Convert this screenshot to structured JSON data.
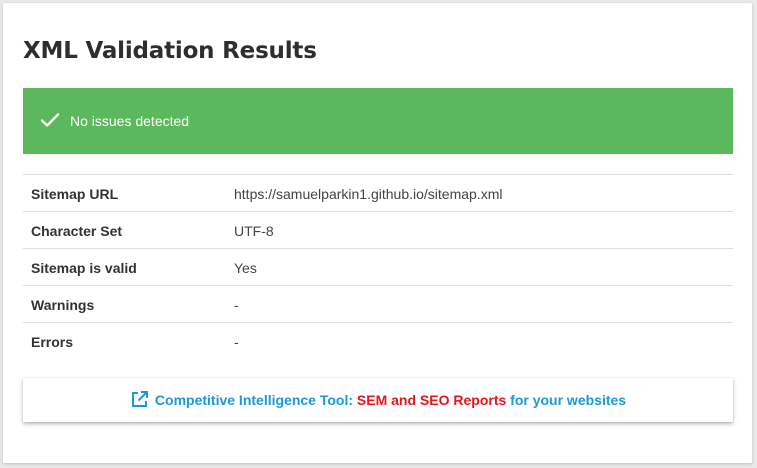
{
  "page": {
    "title": "XML Validation Results"
  },
  "alert": {
    "icon": "checkmark-icon",
    "message": "No issues detected",
    "color": "#5cb85c"
  },
  "results": [
    {
      "label": "Sitemap URL",
      "value": "https://samuelparkin1.github.io/sitemap.xml"
    },
    {
      "label": "Character Set",
      "value": "UTF-8"
    },
    {
      "label": "Sitemap is valid",
      "value": "Yes"
    },
    {
      "label": "Warnings",
      "value": "-"
    },
    {
      "label": "Errors",
      "value": "-"
    }
  ],
  "promo": {
    "icon": "external-link-icon",
    "prefix": "Competitive Intelligence Tool:",
    "highlight": "SEM and SEO Reports",
    "suffix": "for your websites",
    "link_color": "#1a9ad6",
    "highlight_color": "#e8141e"
  }
}
